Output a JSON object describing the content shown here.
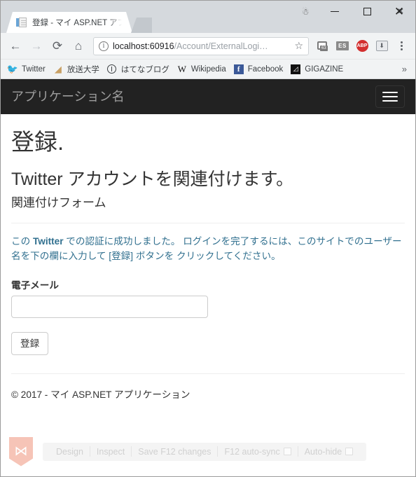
{
  "browser": {
    "tab": {
      "title": "登録 - マイ ASP.NET アプリ",
      "close_label": "✕",
      "favicon": "page-document-icon"
    },
    "window_controls": {
      "profile": "profile-icon",
      "minimize": "minimize-icon",
      "maximize": "maximize-icon",
      "close": "✕"
    },
    "toolbar": {
      "back": "←",
      "forward": "→",
      "reload": "⟳",
      "home": "⌂",
      "security_icon": "i",
      "url_host": "localhost:60916",
      "url_path": "/Account/ExternalLogi…",
      "bookmark_star": "☆",
      "menu": "kebab-menu-icon",
      "extensions": [
        {
          "name": "save-page-extension",
          "label": "63"
        },
        {
          "name": "es-extension",
          "label": "ES"
        },
        {
          "name": "adblock-plus-extension",
          "label": "ABP"
        },
        {
          "name": "download-extension",
          "label": "⬇"
        }
      ]
    },
    "bookmarks": {
      "items": [
        {
          "label": "Twitter",
          "icon": "twitter-icon"
        },
        {
          "label": "放送大学",
          "icon": "hoso-daigaku-icon"
        },
        {
          "label": "はてなブログ",
          "icon": "hatena-blog-icon"
        },
        {
          "label": "Wikipedia",
          "icon": "wikipedia-icon"
        },
        {
          "label": "Facebook",
          "icon": "facebook-icon"
        },
        {
          "label": "GIGAZINE",
          "icon": "gigazine-icon"
        }
      ],
      "overflow": "»"
    }
  },
  "page": {
    "navbar": {
      "brand": "アプリケーション名",
      "toggle": "hamburger-menu-icon"
    },
    "title": "登録.",
    "subtitle": "Twitter アカウントを関連付けます。",
    "form_heading": "関連付けフォーム",
    "info_prefix": "この ",
    "info_provider": "Twitter",
    "info_text": " での認証に成功しました。 ログインを完了するには、このサイトでのユーザー名を下の欄に入力して [登録] ボタンを クリックしてください。",
    "email_label": "電子メール",
    "email_value": "",
    "email_placeholder": "",
    "submit_label": "登録",
    "footer": "© 2017 - マイ ASP.NET アプリケーション"
  },
  "browser_link": {
    "logo": "visual-studio-logo",
    "items": [
      {
        "label": "Design",
        "checkbox": false
      },
      {
        "label": "Inspect",
        "checkbox": false
      },
      {
        "label": "Save F12 changes",
        "checkbox": false
      },
      {
        "label": "F12 auto-sync",
        "checkbox": true
      },
      {
        "label": "Auto-hide",
        "checkbox": true
      }
    ]
  },
  "colors": {
    "navbar_bg": "#222222",
    "brand_text": "#9d9d9d",
    "info_text": "#31708f",
    "vs_logo": "#f6c4b7",
    "twitter_blue": "#1da1f2"
  }
}
